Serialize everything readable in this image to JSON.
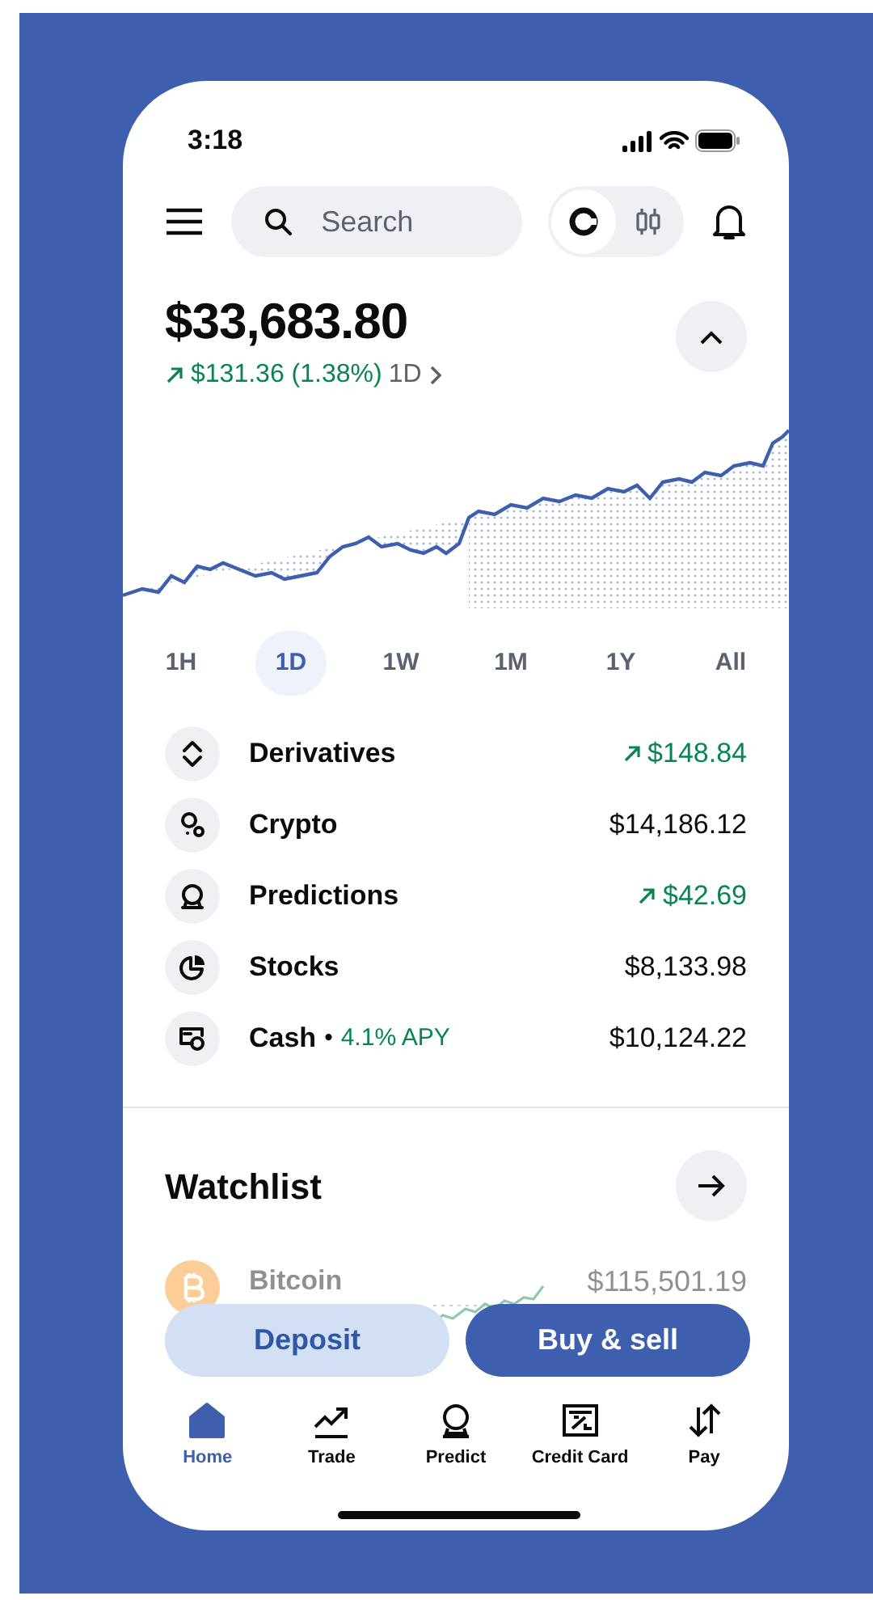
{
  "status_bar": {
    "time": "3:18"
  },
  "search": {
    "placeholder": "Search"
  },
  "view_modes": [
    {
      "kind": "coin",
      "selected": true
    },
    {
      "kind": "candles",
      "selected": false
    }
  ],
  "balance": {
    "total": "$33,683.80",
    "change": "$131.36 (1.38%)",
    "period": "1D"
  },
  "ranges": [
    {
      "label": "1H",
      "selected": false
    },
    {
      "label": "1D",
      "selected": true
    },
    {
      "label": "1W",
      "selected": false
    },
    {
      "label": "1M",
      "selected": false
    },
    {
      "label": "1Y",
      "selected": false
    },
    {
      "label": "All",
      "selected": false
    }
  ],
  "assets": [
    {
      "name": "Derivatives",
      "kind": "change",
      "value": "$148.84"
    },
    {
      "name": "Crypto",
      "kind": "balance",
      "value": "$14,186.12"
    },
    {
      "name": "Predictions",
      "kind": "change",
      "value": "$42.69"
    },
    {
      "name": "Stocks",
      "kind": "balance",
      "value": "$8,133.98"
    },
    {
      "name": "Cash",
      "kind": "balance",
      "separator": "•",
      "note": "4.1% APY",
      "value": "$10,124.22"
    }
  ],
  "watchlist": {
    "title": "Watchlist",
    "items": [
      {
        "name": "Bitcoin",
        "price": "$115,501.19"
      }
    ]
  },
  "actions": [
    {
      "label": "Deposit",
      "kind": "secondary"
    },
    {
      "label": "Buy & sell",
      "kind": "primary"
    }
  ],
  "tabs": [
    {
      "label": "Home",
      "selected": true
    },
    {
      "label": "Trade",
      "selected": false
    },
    {
      "label": "Predict",
      "selected": false
    },
    {
      "label": "Credit Card",
      "selected": false
    },
    {
      "label": "Pay",
      "selected": false
    }
  ]
}
